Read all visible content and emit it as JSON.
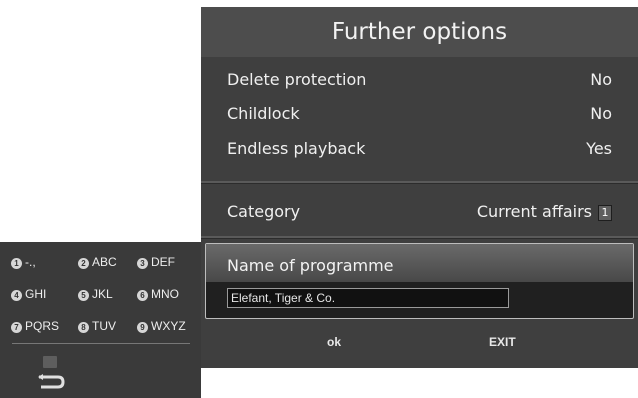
{
  "menu": {
    "title": "Further options",
    "rows": [
      {
        "label": "Delete protection",
        "value": "No"
      },
      {
        "label": "Childlock",
        "value": "No"
      },
      {
        "label": "Endless playback",
        "value": "Yes"
      }
    ],
    "category": {
      "label": "Category",
      "value": "Current affairs",
      "badge": "1"
    },
    "name_field": {
      "label": "Name of programme",
      "value": "Elefant, Tiger & Co."
    },
    "buttons": {
      "ok": "ok",
      "exit": "EXIT"
    }
  },
  "keypad": {
    "keys": [
      {
        "num": "1",
        "chars": "-.,"
      },
      {
        "num": "2",
        "chars": "ABC"
      },
      {
        "num": "3",
        "chars": "DEF"
      },
      {
        "num": "4",
        "chars": "GHI"
      },
      {
        "num": "5",
        "chars": "JKL"
      },
      {
        "num": "6",
        "chars": "MNO"
      },
      {
        "num": "7",
        "chars": "PQRS"
      },
      {
        "num": "8",
        "chars": "TUV"
      },
      {
        "num": "9",
        "chars": "WXYZ"
      }
    ]
  },
  "colors": {
    "panel": "#3f3f3f",
    "title_bar": "#4d4d4d",
    "text": "#f0f0f0",
    "keypad": "#3a3a3a"
  }
}
